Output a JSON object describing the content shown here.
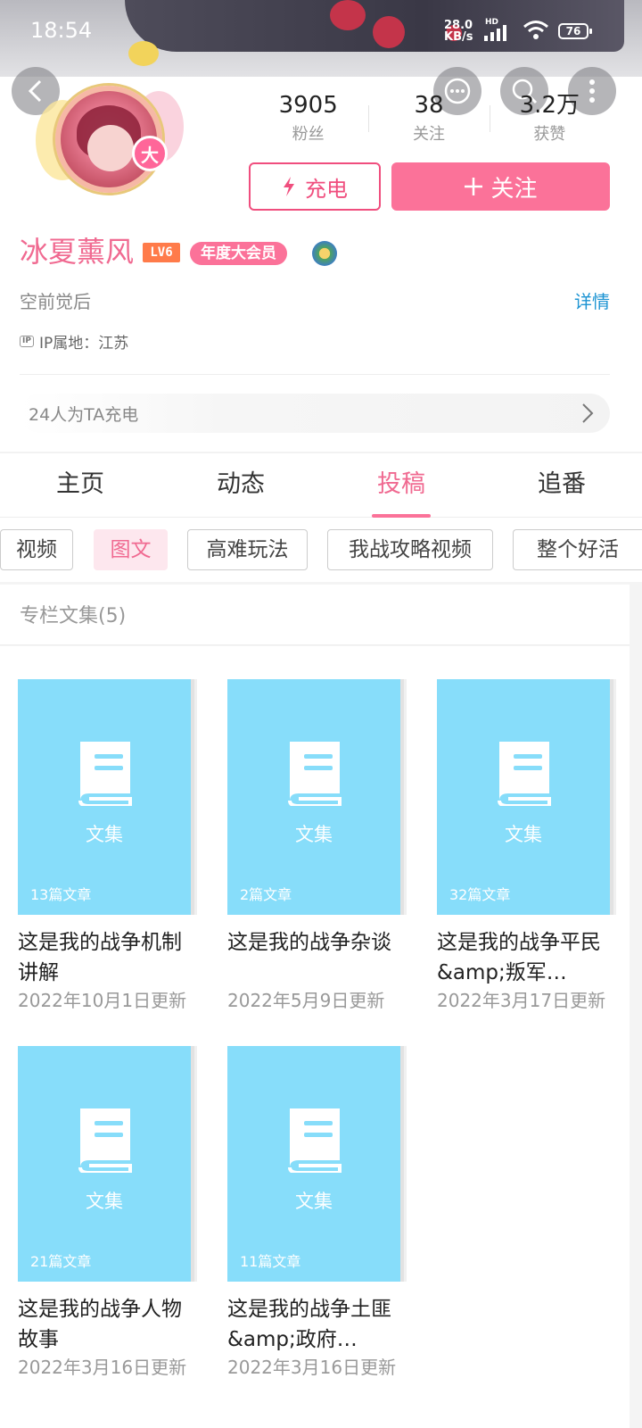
{
  "status_bar": {
    "time": "18:54",
    "net_speed_value": "28.0",
    "net_speed_unit": "KB/s",
    "network_badge": "HD",
    "battery": "76",
    "icons": [
      "signal-icon",
      "wifi-icon",
      "battery-icon"
    ]
  },
  "header": {
    "icons": [
      "back-arrow-icon",
      "message-icon",
      "search-icon",
      "more-vertical-icon"
    ]
  },
  "profile": {
    "avatar_badge": "大",
    "stats": [
      {
        "value": "3905",
        "label": "粉丝"
      },
      {
        "value": "38",
        "label": "关注"
      },
      {
        "value": "3.2万",
        "label": "获赞"
      }
    ],
    "charge_button": "充电",
    "follow_button": "关注",
    "name": "冰夏薰风",
    "level": "LV6",
    "vip_badge": "年度大会员",
    "signature": "空前觉后",
    "detail_link": "详情",
    "ip_icon": "IP",
    "ip_location": "IP属地：江苏",
    "charge_count_text": "24人为TA充电"
  },
  "tabs": [
    {
      "label": "主页"
    },
    {
      "label": "动态"
    },
    {
      "label": "投稿",
      "active": true
    },
    {
      "label": "追番"
    }
  ],
  "chips": [
    {
      "label": "视频"
    },
    {
      "label": "图文",
      "active": true
    },
    {
      "label": "高难玩法"
    },
    {
      "label": "我战攻略视频"
    },
    {
      "label": "整个好活"
    }
  ],
  "collections": {
    "header": "专栏文集(5)",
    "cover_label": "文集",
    "items": [
      {
        "count": "13篇文章",
        "title": "这是我的战争机制讲解",
        "updated": "2022年10月1日更新"
      },
      {
        "count": "2篇文章",
        "title": "这是我的战争杂谈",
        "updated": "2022年5月9日更新"
      },
      {
        "count": "32篇文章",
        "title": "这是我的战争平民&amp;叛军…",
        "updated": "2022年3月17日更新"
      },
      {
        "count": "21篇文章",
        "title": "这是我的战争人物故事",
        "updated": "2022年3月16日更新"
      },
      {
        "count": "11篇文章",
        "title": "这是我的战争土匪&amp;政府…",
        "updated": "2022年3月16日更新"
      }
    ]
  },
  "colors": {
    "accent": "#fb7299",
    "accent_text": "#f06a91",
    "link": "#1d94d3",
    "cover": "#87ddfa",
    "level_badge": "#ff7b4a"
  }
}
